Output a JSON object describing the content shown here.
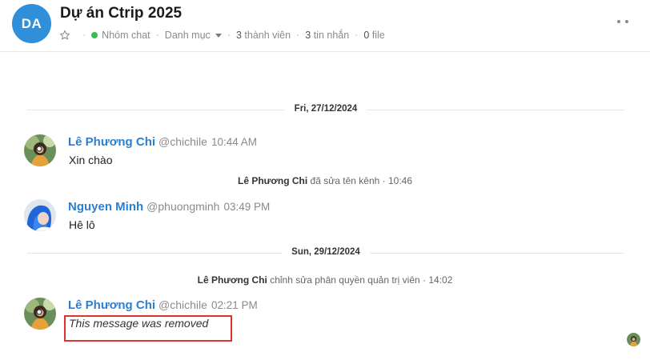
{
  "header": {
    "avatar_initials": "DA",
    "title": "Dự án Ctrip 2025",
    "channel_type": "Nhóm chat",
    "category": "Danh mục",
    "members_count": "3",
    "members_label": "thành viên",
    "messages_count": "3",
    "messages_label": "tin nhắn",
    "files_count": "0",
    "files_label": "file",
    "icons": [
      "star-icon",
      "online-status-dot",
      "chevron-down-icon",
      "more-options-icon"
    ]
  },
  "colors": {
    "accent": "#2a7fd1",
    "avatar_bg": "#2f8fd8",
    "online": "#3cba54",
    "highlight": "#e0332e"
  },
  "timeline": {
    "date1": "Fri, 27/12/2024",
    "date2": "Sun, 29/12/2024",
    "posts": [
      {
        "name": "Lê Phương Chi",
        "handle": "@chichile",
        "time": "10:44 AM",
        "text": "Xin chào"
      },
      {
        "name": "Nguyen Minh",
        "handle": "@phuongminh",
        "time": "03:49 PM",
        "text": "Hê lô"
      },
      {
        "name": "Lê Phương Chi",
        "handle": "@chichile",
        "time": "02:21 PM",
        "text": "This message was removed"
      }
    ],
    "system": [
      {
        "actor": "Lê Phương Chi",
        "text": "đã sửa tên kênh · 10:46"
      },
      {
        "actor": "Lê Phương Chi",
        "text": "chỉnh sửa phân quyền quản trị viên · 14:02"
      }
    ]
  }
}
